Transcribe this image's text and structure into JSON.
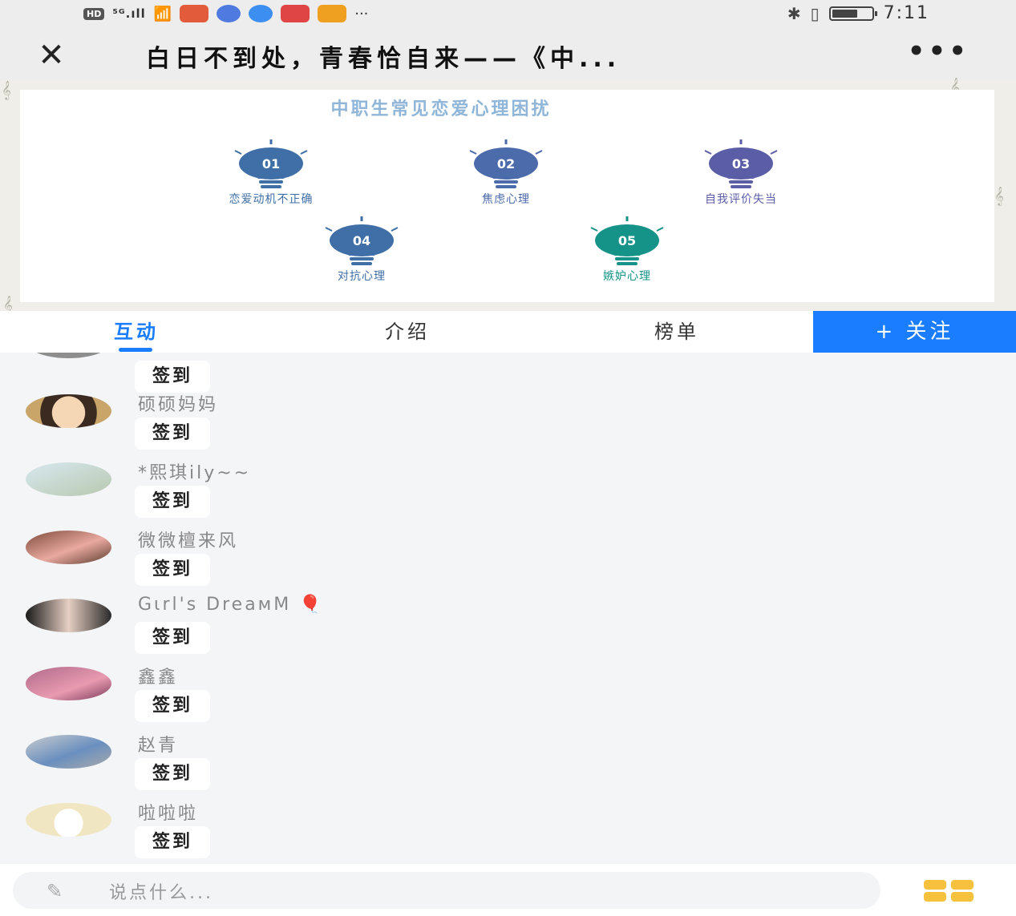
{
  "status_bar": {
    "hd": "HD",
    "network": "⁵ᴳ.ıll",
    "ellipsis": "···",
    "time": "7:11"
  },
  "header": {
    "close": "✕",
    "title": "白日不到处，青春恰自来——《中...",
    "more": "•••"
  },
  "slide": {
    "title": "中职生常见恋爱心理困扰",
    "items": [
      {
        "num": "01",
        "label": "恋爱动机不正确",
        "color": "#3f6fa6"
      },
      {
        "num": "02",
        "label": "焦虑心理",
        "color": "#4c6bab"
      },
      {
        "num": "03",
        "label": "自我评价失当",
        "color": "#5b5ea6"
      },
      {
        "num": "04",
        "label": "对抗心理",
        "color": "#3f6fa6"
      },
      {
        "num": "05",
        "label": "嫉妒心理",
        "color": "#169389"
      }
    ]
  },
  "tabs": {
    "interact": "互动",
    "intro": "介绍",
    "ranking": "榜单",
    "follow": "+ 关注"
  },
  "feed": {
    "checkin_label": "签到",
    "users": [
      {
        "name": "硕硕妈妈"
      },
      {
        "name": "*熙琪ily~~"
      },
      {
        "name": "微微檀来风"
      },
      {
        "name": "Gɩrl's DreaᴍM 🎈"
      },
      {
        "name": "鑫鑫"
      },
      {
        "name": "赵青"
      },
      {
        "name": "啦啦啦"
      }
    ]
  },
  "composer": {
    "placeholder": "说点什么..."
  },
  "colors": {
    "accent": "#1a7cff",
    "grid_icon": "#f6c23e"
  }
}
